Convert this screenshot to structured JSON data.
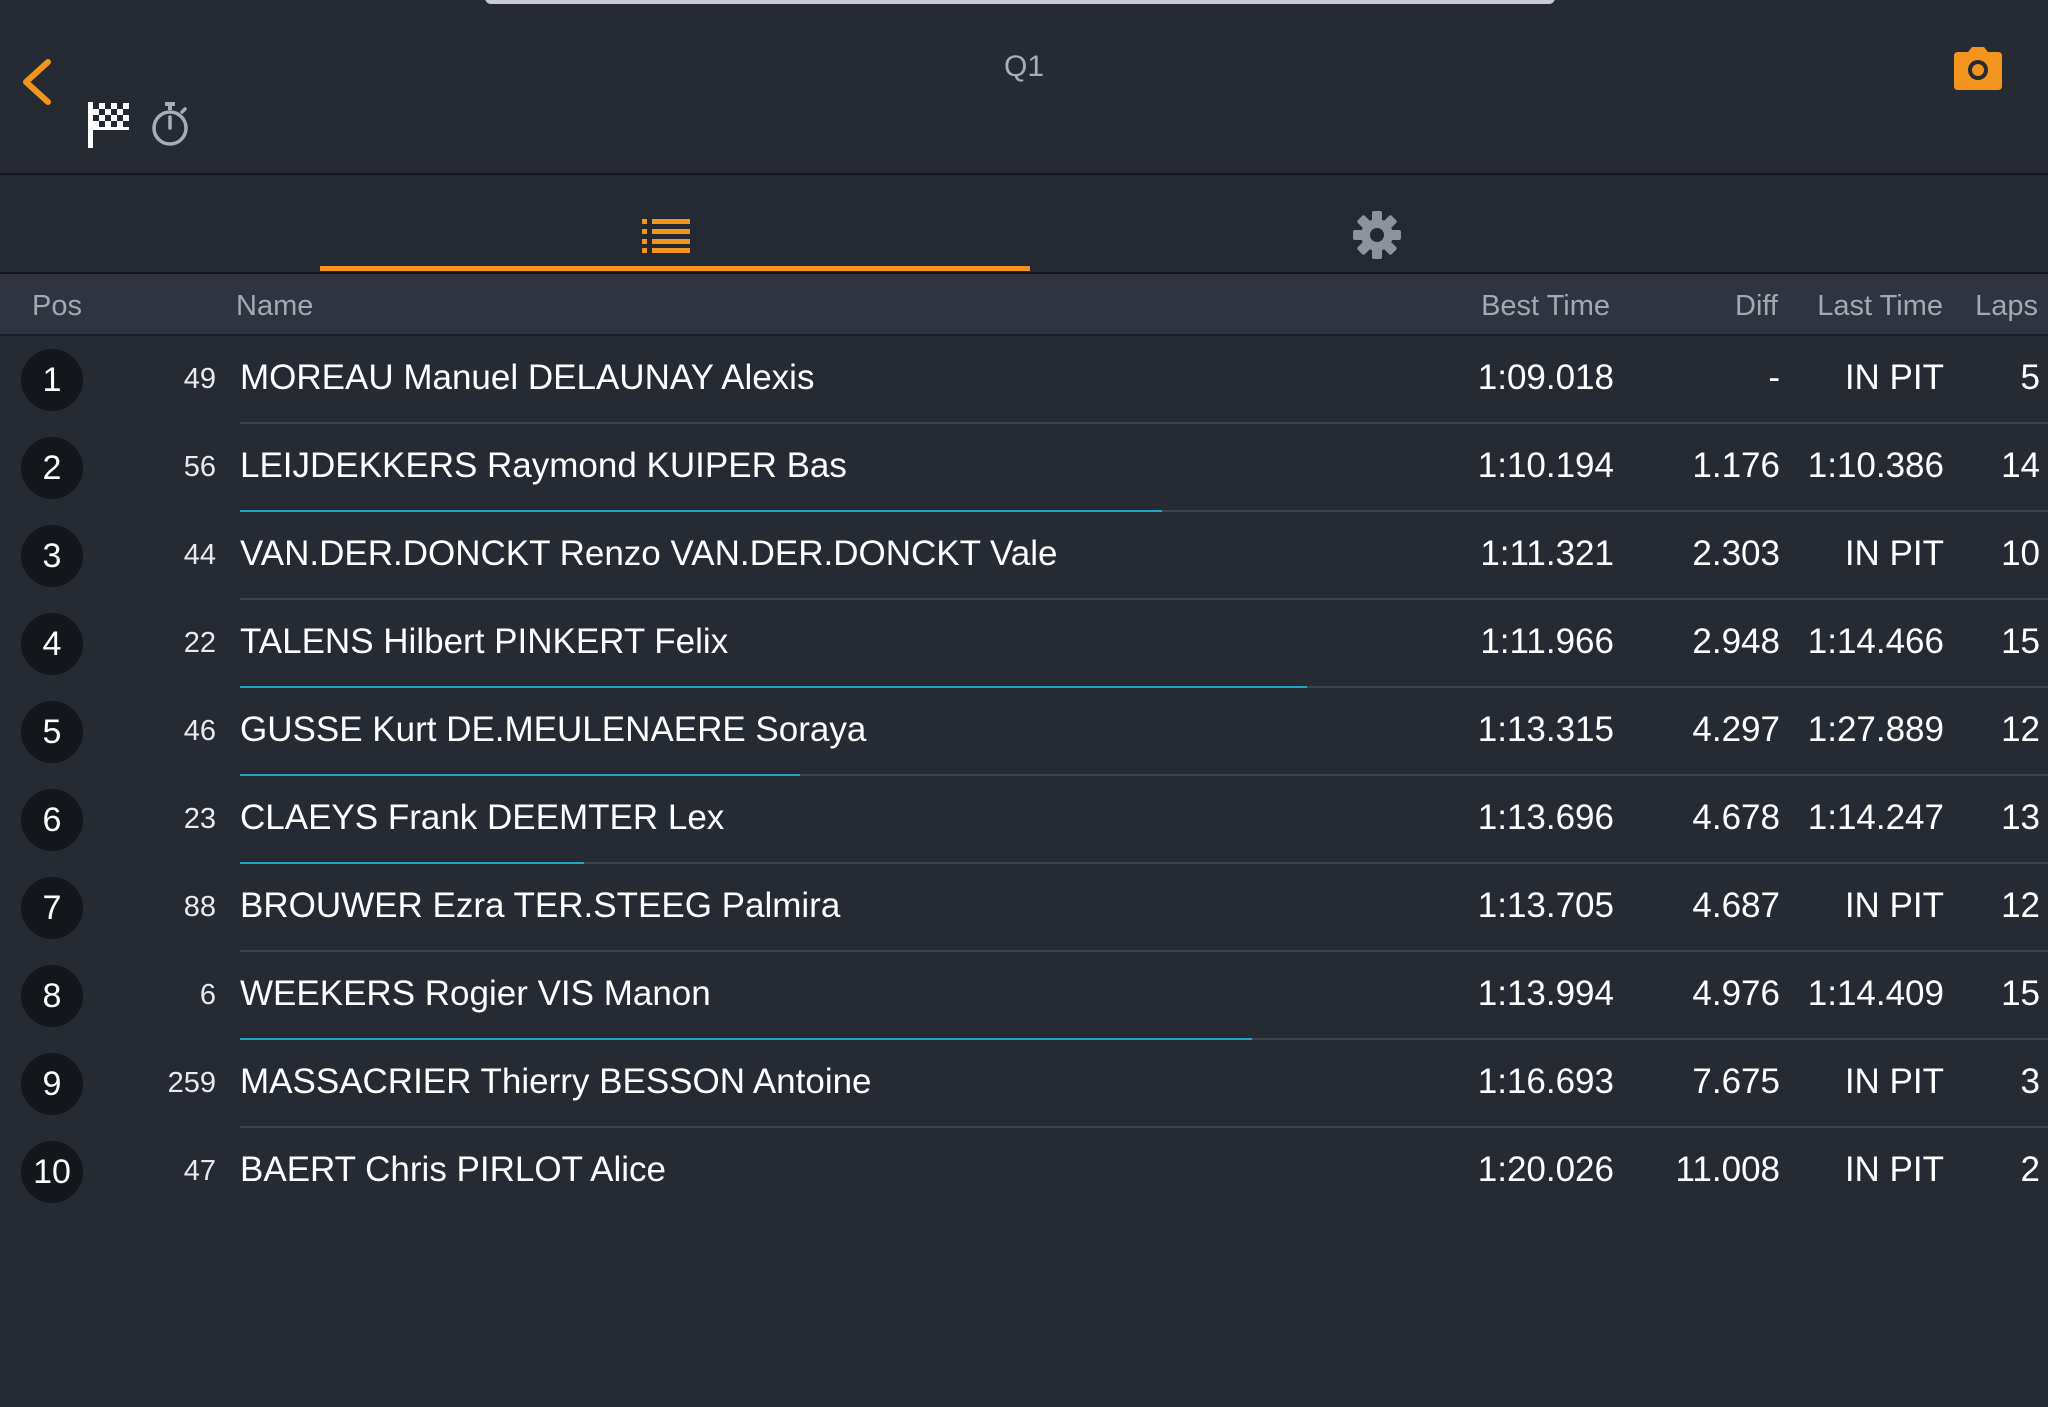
{
  "header": {
    "title": "Q1",
    "back_icon": "chevron-left-icon",
    "flag_icon": "checkered-flag-icon",
    "timer_icon": "stopwatch-icon",
    "camera_icon": "camera-icon",
    "accent_color": "#f3941e"
  },
  "tabs": [
    {
      "name": "standings",
      "icon": "list-icon",
      "active": true
    },
    {
      "name": "settings",
      "icon": "gear-icon",
      "active": false
    }
  ],
  "columns": {
    "pos": "Pos",
    "name": "Name",
    "best_time": "Best Time",
    "diff": "Diff",
    "last_time": "Last Time",
    "laps": "Laps"
  },
  "rows": [
    {
      "pos": "1",
      "number": "49",
      "name": "MOREAU Manuel DELAUNAY Alexis",
      "best": "1:09.018",
      "diff": "-",
      "last": "IN PIT",
      "laps": "5",
      "lap_progress": 0
    },
    {
      "pos": "2",
      "number": "56",
      "name": "LEIJDEKKERS Raymond KUIPER Bas",
      "best": "1:10.194",
      "diff": "1.176",
      "last": "1:10.386",
      "laps": "14",
      "lap_progress": 0.51
    },
    {
      "pos": "3",
      "number": "44",
      "name": "VAN.DER.DONCKT Renzo VAN.DER.DONCKT Vale",
      "best": "1:11.321",
      "diff": "2.303",
      "last": "IN PIT",
      "laps": "10",
      "lap_progress": 0
    },
    {
      "pos": "4",
      "number": "22",
      "name": "TALENS Hilbert PINKERT Felix",
      "best": "1:11.966",
      "diff": "2.948",
      "last": "1:14.466",
      "laps": "15",
      "lap_progress": 0.59
    },
    {
      "pos": "5",
      "number": "46",
      "name": "GUSSE Kurt DE.MEULENAERE Soraya",
      "best": "1:13.315",
      "diff": "4.297",
      "last": "1:27.889",
      "laps": "12",
      "lap_progress": 0.31
    },
    {
      "pos": "6",
      "number": "23",
      "name": "CLAEYS Frank DEEMTER Lex",
      "best": "1:13.696",
      "diff": "4.678",
      "last": "1:14.247",
      "laps": "13",
      "lap_progress": 0.19
    },
    {
      "pos": "7",
      "number": "88",
      "name": "BROUWER Ezra TER.STEEG Palmira",
      "best": "1:13.705",
      "diff": "4.687",
      "last": "IN PIT",
      "laps": "12",
      "lap_progress": 0
    },
    {
      "pos": "8",
      "number": "6",
      "name": "WEEKERS Rogier VIS Manon",
      "best": "1:13.994",
      "diff": "4.976",
      "last": "1:14.409",
      "laps": "15",
      "lap_progress": 0.56
    },
    {
      "pos": "9",
      "number": "259",
      "name": "MASSACRIER Thierry BESSON Antoine",
      "best": "1:16.693",
      "diff": "7.675",
      "last": "IN PIT",
      "laps": "3",
      "lap_progress": 0
    },
    {
      "pos": "10",
      "number": "47",
      "name": "BAERT Chris PIRLOT Alice",
      "best": "1:20.026",
      "diff": "11.008",
      "last": "IN PIT",
      "laps": "2",
      "lap_progress": 0
    }
  ]
}
